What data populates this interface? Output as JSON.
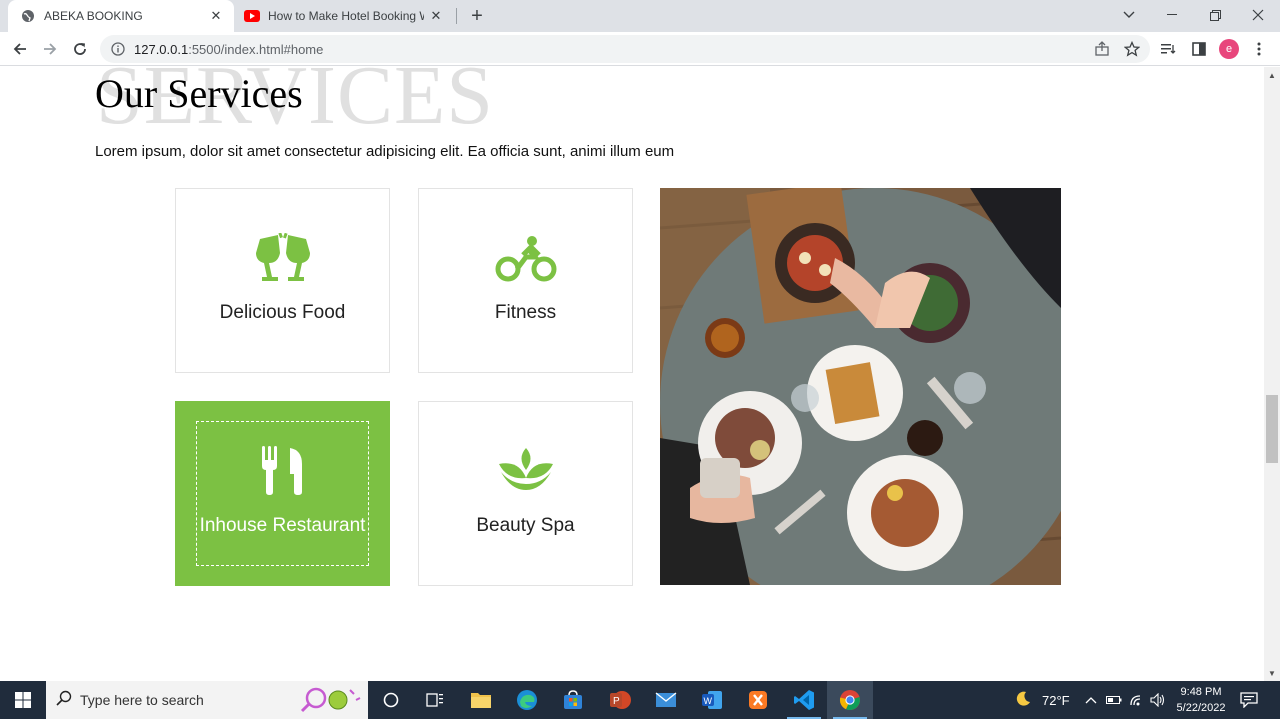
{
  "browser": {
    "tabs": [
      {
        "title": "ABEKA BOOKING",
        "active": true
      },
      {
        "title": "How to Make Hotel Booking We",
        "active": false
      }
    ],
    "url_host": "127.0.0.1",
    "url_rest": ":5500/index.html#home",
    "profile_initial": "e"
  },
  "page": {
    "bg_word": "SERVICES",
    "heading": "Our Services",
    "lead": "Lorem ipsum, dolor sit amet consectetur adipisicing elit. Ea officia sunt, animi illum eum",
    "services": [
      {
        "label": "Delicious Food",
        "icon": "wine-glasses-icon"
      },
      {
        "label": "Fitness",
        "icon": "bicycle-icon"
      },
      {
        "label": "Inhouse Restaurant",
        "icon": "fork-knife-icon",
        "active": true
      },
      {
        "label": "Beauty Spa",
        "icon": "leaf-spa-icon"
      }
    ],
    "accent_color": "#7cc143"
  },
  "taskbar": {
    "search_placeholder": "Type here to search",
    "weather": "72°F",
    "time": "9:48 PM",
    "date": "5/22/2022"
  }
}
